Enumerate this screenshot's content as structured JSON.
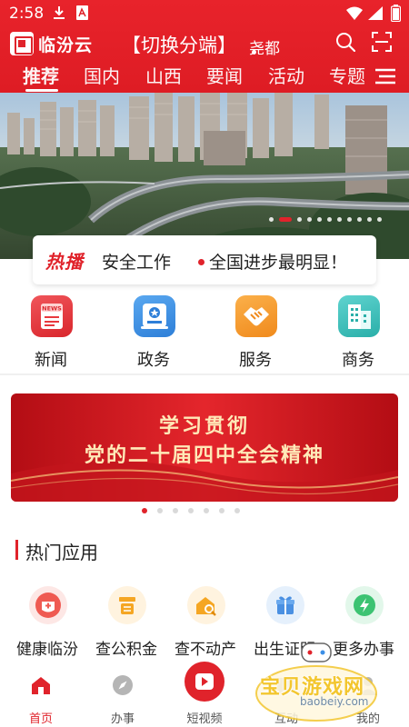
{
  "status_bar": {
    "time": "2:58"
  },
  "app": {
    "name": "临汾云"
  },
  "header": {
    "switch_label": "【切换分端】",
    "city": "尧都"
  },
  "tabs": [
    {
      "label": "推荐",
      "active": true
    },
    {
      "label": "国内"
    },
    {
      "label": "山西"
    },
    {
      "label": "要闻"
    },
    {
      "label": "活动"
    },
    {
      "label": "专题"
    }
  ],
  "banner": {
    "slide_count": 11,
    "active_slide": 2
  },
  "hot": {
    "badge": "热播",
    "item1": "安全工作",
    "item2": "全国进步最明显！"
  },
  "quick": [
    {
      "label": "新闻",
      "icon": "news-icon",
      "color": "#e8383d"
    },
    {
      "label": "政务",
      "icon": "gov-badge-icon",
      "color": "#3c8fe6"
    },
    {
      "label": "服务",
      "icon": "handshake-icon",
      "color": "#f59a2e"
    },
    {
      "label": "商务",
      "icon": "building-icon",
      "color": "#3bbfbf"
    }
  ],
  "promo": {
    "line1": "学习贯彻",
    "line2": "党的二十届四中全会精神",
    "slide_count": 7,
    "active_slide": 1
  },
  "hot_apps": {
    "title": "热门应用",
    "items": [
      {
        "label": "健康临汾",
        "icon": "health-icon",
        "color": "#ef5a52"
      },
      {
        "label": "查公积金",
        "icon": "fund-icon",
        "color": "#f5a623"
      },
      {
        "label": "查不动产",
        "icon": "property-icon",
        "color": "#f5a623"
      },
      {
        "label": "出生证明",
        "icon": "gift-icon",
        "color": "#4a90e2"
      },
      {
        "label": "更多办事",
        "icon": "bolt-icon",
        "color": "#3cc372"
      }
    ]
  },
  "bottom_nav": [
    {
      "label": "首页",
      "icon": "home-icon",
      "active": true
    },
    {
      "label": "办事",
      "icon": "compass-icon"
    },
    {
      "label": "短视频",
      "icon": "play-icon"
    },
    {
      "label": "互动",
      "icon": "chat-icon"
    },
    {
      "label": "我的",
      "icon": "user-icon"
    }
  ],
  "watermark": {
    "text": "宝贝游戏网",
    "url": "baobeiy.com"
  },
  "colors": {
    "brand_red": "#e0232b",
    "promo_gold": "#ffe9b8"
  }
}
